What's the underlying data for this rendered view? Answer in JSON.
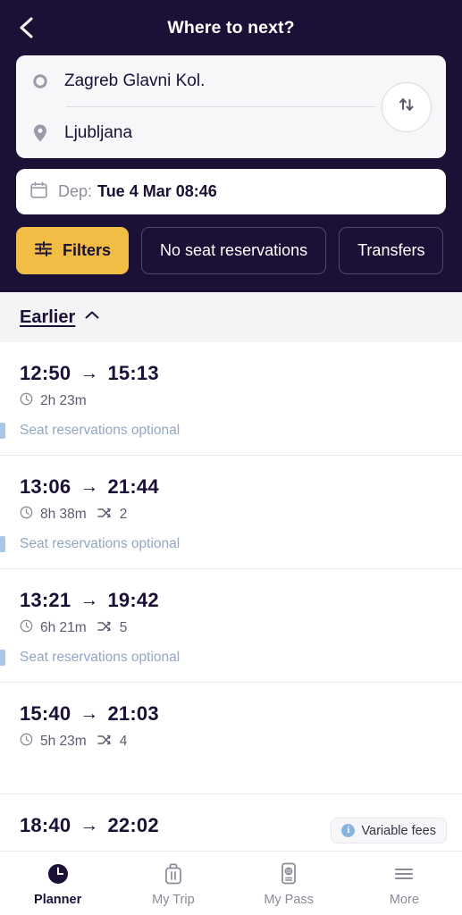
{
  "header": {
    "title": "Where to next?",
    "back_icon": "chevron-left-icon",
    "origin": {
      "value": "Zagreb Glavni Kol.",
      "marker_icon": "circle-marker-icon"
    },
    "destination": {
      "value": "Ljubljana",
      "marker_icon": "map-pin-icon"
    },
    "swap_icon": "swap-vertical-icon",
    "date": {
      "calendar_icon": "calendar-icon",
      "prefix": "Dep:",
      "value": "Tue 4 Mar 08:46"
    },
    "chips": [
      {
        "label": "Filters",
        "icon": "sliders-icon",
        "style": "primary"
      },
      {
        "label": "No seat reservations",
        "icon": "",
        "style": "outline"
      },
      {
        "label": "Transfers",
        "icon": "",
        "style": "outline"
      }
    ]
  },
  "results": {
    "earlier": {
      "label": "Earlier",
      "icon": "chevron-up-icon"
    },
    "journeys": [
      {
        "depart": "12:50",
        "arrow": "→",
        "arrive": "15:13",
        "duration": "2h 23m",
        "clock_icon": "clock-icon",
        "transfers_icon": "transfer-icon",
        "transfers": "",
        "tag": "Seat reservations optional"
      },
      {
        "depart": "13:06",
        "arrow": "→",
        "arrive": "21:44",
        "duration": "8h 38m",
        "clock_icon": "clock-icon",
        "transfers_icon": "transfer-icon",
        "transfers": "2",
        "tag": "Seat reservations optional"
      },
      {
        "depart": "13:21",
        "arrow": "→",
        "arrive": "19:42",
        "duration": "6h 21m",
        "clock_icon": "clock-icon",
        "transfers_icon": "transfer-icon",
        "transfers": "5",
        "tag": "Seat reservations optional"
      },
      {
        "depart": "15:40",
        "arrow": "→",
        "arrive": "21:03",
        "duration": "5h 23m",
        "clock_icon": "clock-icon",
        "transfers_icon": "transfer-icon",
        "transfers": "4",
        "tag": ""
      },
      {
        "depart": "18:40",
        "arrow": "→",
        "arrive": "22:02",
        "duration": "",
        "clock_icon": "",
        "transfers_icon": "",
        "transfers": "",
        "tag": ""
      }
    ]
  },
  "fees_badge": {
    "label": "Variable fees",
    "icon": "info-icon",
    "symbol": "i"
  },
  "bottom_nav": [
    {
      "label": "Planner",
      "icon": "clock-filled-icon",
      "active": true
    },
    {
      "label": "My Trip",
      "icon": "suitcase-icon",
      "active": false
    },
    {
      "label": "My Pass",
      "icon": "passport-icon",
      "active": false
    },
    {
      "label": "More",
      "icon": "hamburger-icon",
      "active": false
    }
  ],
  "colors": {
    "header_bg": "#1b1035",
    "accent_yellow": "#f2bd45",
    "tag_blue": "#93a7c4",
    "accent_bar": "#a8c7e8"
  }
}
